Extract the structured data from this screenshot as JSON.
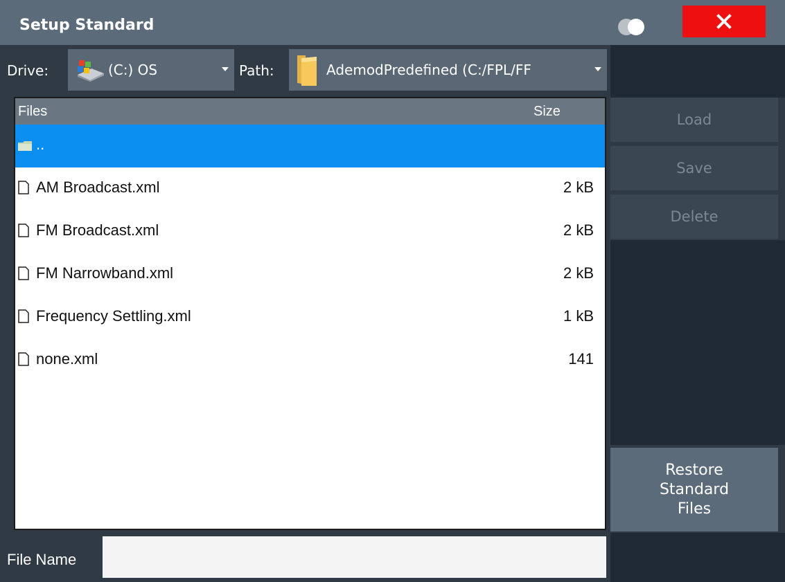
{
  "window": {
    "title": "Setup Standard"
  },
  "drive": {
    "label": "Drive:",
    "value": "(C:) OS"
  },
  "path": {
    "label": "Path:",
    "value": "AdemodPredefined (C:/FPL/FF"
  },
  "table": {
    "headers": {
      "files": "Files",
      "size": "Size"
    },
    "rows": [
      {
        "name": "..",
        "size": "",
        "type": "folder",
        "selected": true
      },
      {
        "name": "AM Broadcast.xml",
        "size": "2 kB",
        "type": "file"
      },
      {
        "name": "FM Broadcast.xml",
        "size": "2 kB",
        "type": "file"
      },
      {
        "name": "FM Narrowband.xml",
        "size": "2 kB",
        "type": "file"
      },
      {
        "name": "Frequency Settling.xml",
        "size": "1 kB",
        "type": "file"
      },
      {
        "name": "none.xml",
        "size": "141",
        "type": "file"
      }
    ]
  },
  "buttons": {
    "load": "Load",
    "save": "Save",
    "delete": "Delete",
    "restore": "Restore Standard Files"
  },
  "filename": {
    "label": "File Name",
    "value": ""
  },
  "colors": {
    "titlebar": "#5b6b79",
    "background": "#2f3a45",
    "selection": "#0a8eef",
    "close": "#ee1010"
  },
  "icons": {
    "close": "close-icon",
    "toggle": "toggle-icon",
    "drive": "windows-drive-icon",
    "path": "folder-icon",
    "file": "file-icon",
    "folder": "folder-icon"
  }
}
